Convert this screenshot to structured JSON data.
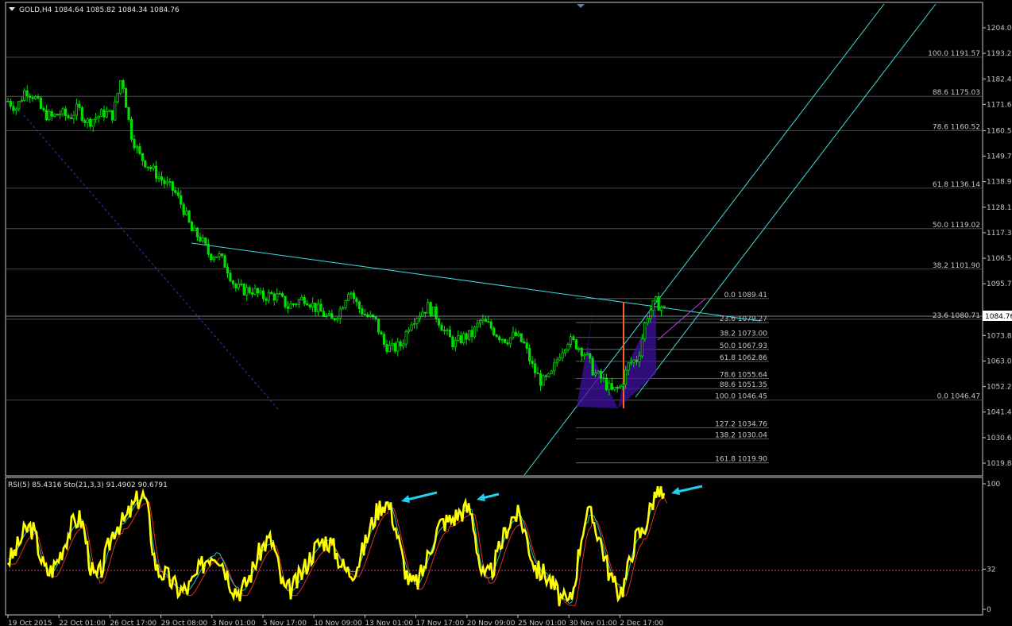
{
  "main_header": "GOLD,H4  1084.64 1085.82 1084.34 1084.76",
  "indicator_header": "RSI(5) 85.4316  Sto(21,3,3) 91.4902 90.6791",
  "current_price": "1084.76",
  "colors": {
    "bull": "#00e000",
    "bear": "#00e000",
    "rsi": "#ffff00",
    "sto_main": "#20c0c0",
    "sto_signal": "#e03020",
    "trend": "#40e0e0",
    "fib": "#7a7a7a",
    "harmonic": "#5010a0",
    "vline": "#ff6020"
  },
  "chart_data": [
    {
      "type": "candlestick",
      "symbol": "GOLD,H4",
      "ohlc_last": {
        "open": 1084.64,
        "high": 1085.82,
        "low": 1084.34,
        "close": 1084.76
      },
      "ylim": [
        1015.0,
        1210.0
      ],
      "y_ticks": [
        "1204.00",
        "1193.20",
        "1182.40",
        "1171.60",
        "1160.50",
        "1149.70",
        "1138.90",
        "1128.10",
        "1117.30",
        "1106.50",
        "1095.70",
        "1084.76",
        "1073.80",
        "1063.00",
        "1052.20",
        "1041.40",
        "1030.60",
        "1019.80"
      ],
      "x_ticks": [
        "19 Oct 2015",
        "22 Oct 01:00",
        "26 Oct 17:00",
        "29 Oct 08:00",
        "3 Nov 01:00",
        "5 Nov 17:00",
        "10 Nov 09:00",
        "13 Nov 01:00",
        "17 Nov 17:00",
        "20 Nov 09:00",
        "25 Nov 01:00",
        "30 Nov 01:00",
        "2 Dec 17:00"
      ],
      "close_path": [
        1173,
        1170,
        1178,
        1175,
        1168,
        1166,
        1168,
        1166,
        1170,
        1164,
        1166,
        1168,
        1167,
        1184,
        1160,
        1150,
        1146,
        1142,
        1138,
        1135,
        1128,
        1118,
        1115,
        1108,
        1108,
        1103,
        1094,
        1093,
        1093,
        1090,
        1091,
        1090,
        1086,
        1088,
        1090,
        1086,
        1083,
        1080,
        1085,
        1094,
        1086,
        1082,
        1080,
        1070,
        1068,
        1070,
        1080,
        1083,
        1086,
        1082,
        1075,
        1070,
        1073,
        1074,
        1080,
        1078,
        1074,
        1072,
        1074,
        1070,
        1060,
        1054,
        1056,
        1066,
        1072,
        1070,
        1066,
        1058,
        1055,
        1050,
        1052,
        1062,
        1064,
        1082,
        1088,
        1085
      ],
      "fib_left": [
        {
          "label": "0.0  1089.41"
        },
        {
          "label": "23.6  1079.27"
        },
        {
          "label": "38.2  1073.00"
        },
        {
          "label": "50.0  1067.93"
        },
        {
          "label": "61.8  1062.86"
        },
        {
          "label": "78.6  1055.64"
        },
        {
          "label": "88.6  1051.35"
        },
        {
          "label": "100.0  1046.45"
        },
        {
          "label": "127.2  1034.76"
        },
        {
          "label": "138.2  1030.04"
        },
        {
          "label": "161.8  1019.90"
        }
      ],
      "fib_right": [
        {
          "label": "100.0  1191.57"
        },
        {
          "label": "88.6  1175.03"
        },
        {
          "label": "78.6  1160.52"
        },
        {
          "label": "61.8  1136.14"
        },
        {
          "label": "50.0  1119.02"
        },
        {
          "label": "38.2  1101.90"
        },
        {
          "label": "23.6  1080.71"
        },
        {
          "label": "0.0  1046.47"
        }
      ]
    },
    {
      "type": "line",
      "name": "RSI(5) / Sto(21,3,3)",
      "ylim": [
        0,
        100
      ],
      "y_ticks": [
        "100",
        "32",
        "0"
      ],
      "level": 32
    }
  ]
}
